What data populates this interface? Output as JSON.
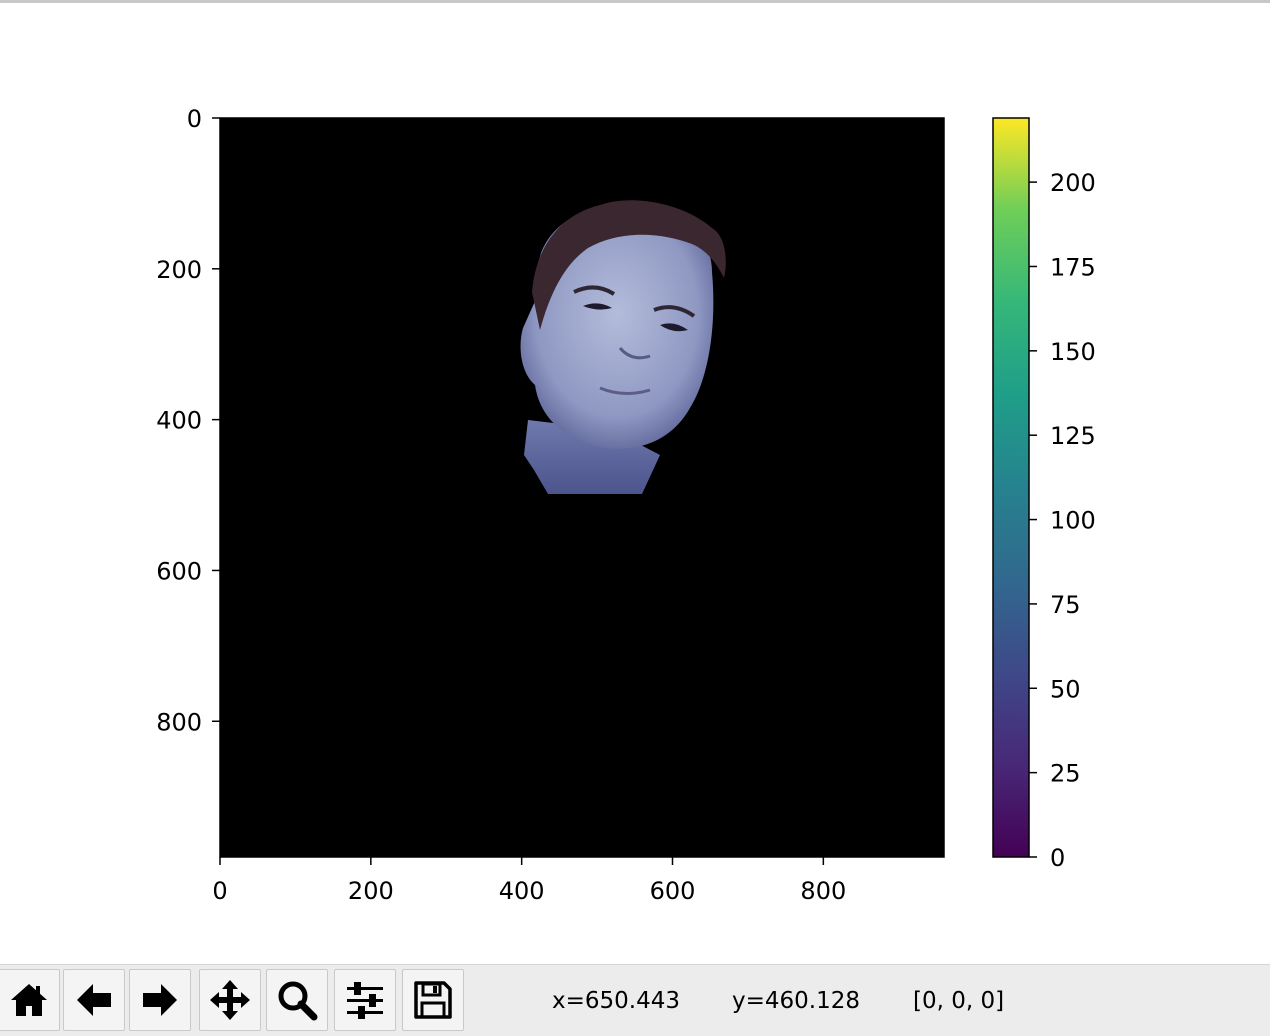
{
  "chart_data": {
    "type": "heatmap",
    "x_ticks": [
      "0",
      "200",
      "400",
      "600",
      "800"
    ],
    "x_tick_values": [
      0,
      200,
      400,
      600,
      800
    ],
    "y_ticks": [
      "0",
      "200",
      "400",
      "600",
      "800"
    ],
    "y_tick_values": [
      0,
      200,
      400,
      600,
      800
    ],
    "xlim": [
      0,
      960
    ],
    "ylim": [
      980,
      0
    ],
    "colorbar": {
      "ticks": [
        "0",
        "25",
        "50",
        "75",
        "100",
        "125",
        "150",
        "175",
        "200"
      ],
      "tick_values": [
        0,
        25,
        50,
        75,
        100,
        125,
        150,
        175,
        200
      ],
      "range": [
        0,
        219
      ],
      "colormap": "viridis"
    },
    "image_background": "#000000",
    "image_content": "masked photo of a face on black background"
  },
  "toolbar": {
    "buttons": [
      {
        "name": "home",
        "icon": "home-icon"
      },
      {
        "name": "back",
        "icon": "arrow-left-icon"
      },
      {
        "name": "forward",
        "icon": "arrow-right-icon"
      },
      {
        "name": "pan",
        "icon": "move-icon"
      },
      {
        "name": "zoom",
        "icon": "magnifier-icon"
      },
      {
        "name": "configure-subplots",
        "icon": "sliders-icon"
      },
      {
        "name": "save",
        "icon": "floppy-disk-icon"
      }
    ],
    "coord_x": "x=650.443",
    "coord_y": "y=460.128",
    "pixel_value": "[0, 0, 0]"
  }
}
